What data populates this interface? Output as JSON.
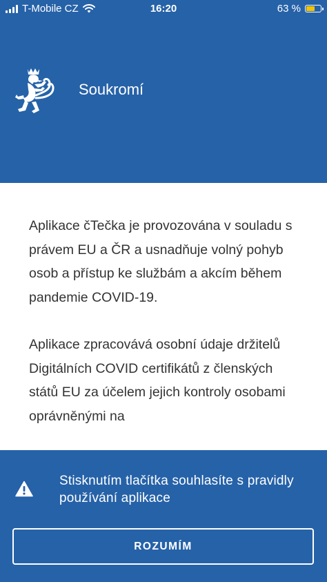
{
  "status_bar": {
    "carrier": "T-Mobile CZ",
    "time": "16:20",
    "battery_percent": "63 %",
    "battery_level": 0.63,
    "battery_fill_color": "#f5c400",
    "icons": [
      "signal-icon",
      "wifi-icon",
      "battery-icon"
    ]
  },
  "header": {
    "title": "Soukromí",
    "logo": "czech-lion-coat-of-arms",
    "background": "#2662a8"
  },
  "content": {
    "paragraphs": [
      "Aplikace čTečka je provozována v souladu s právem EU a ČR a usnadňuje volný pohyb osob a přístup ke službám a akcím během pandemie COVID-19.",
      "Aplikace zpracovává osobní údaje držitelů Digitálních COVID certifikátů z členských států EU za účelem jejich kontroly osobami oprávněnými na"
    ]
  },
  "consent": {
    "icon": "warning-icon",
    "text": "Stisknutím tlačítka souhlasíte s pravidly používání aplikace",
    "button_label": "ROZUMÍM"
  },
  "colors": {
    "brand_blue": "#2662a8",
    "text": "#333333",
    "on_brand": "#ffffff"
  }
}
